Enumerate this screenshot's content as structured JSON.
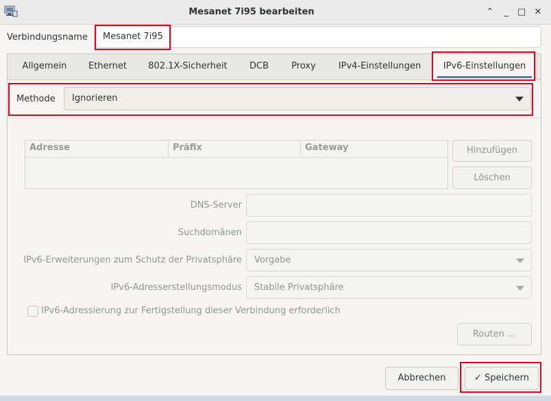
{
  "window": {
    "title": "Mesanet 7i95 bearbeiten",
    "minimize_glyph": "⌃",
    "minimize2_glyph": "_",
    "maximize_glyph": "□",
    "close_glyph": "✕"
  },
  "connection": {
    "name_label": "Verbindungsname",
    "name_value": "Mesanet 7i95"
  },
  "tabs": [
    {
      "label": "Allgemein"
    },
    {
      "label": "Ethernet"
    },
    {
      "label": "802.1X-Sicherheit"
    },
    {
      "label": "DCB"
    },
    {
      "label": "Proxy"
    },
    {
      "label": "IPv4-Einstellungen"
    },
    {
      "label": "IPv6-Einstellungen"
    }
  ],
  "ipv6": {
    "method_label": "Methode",
    "method_value": "Ignorieren",
    "address_table": {
      "columns": [
        "Adresse",
        "Präfix",
        "Gateway"
      ],
      "rows": []
    },
    "add_button": "Hinzufügen",
    "delete_button": "Löschen",
    "dns_label": "DNS-Server",
    "dns_value": "",
    "search_domains_label": "Suchdomänen",
    "search_domains_value": "",
    "privacy_label": "IPv6-Erweiterungen zum Schutz der Privatsphäre",
    "privacy_value": "Vorgabe",
    "addr_gen_label": "IPv6-Adresserstellungsmodus",
    "addr_gen_value": "Stabile Privatsphäre",
    "require_label": "IPv6-Adressierung zur Fertigstellung dieser Verbindung erforderlich",
    "require_checked": false,
    "routes_button": "Routen …"
  },
  "footer": {
    "cancel_button": "Abbrechen",
    "save_button": "Speichern",
    "save_icon_glyph": "✓"
  },
  "icons": {
    "app": "network-connection-icon",
    "checkmark": "checkmark-icon",
    "dropdown": "chevron-down-icon"
  },
  "colors": {
    "accent": "#3584e4",
    "highlight": "#e8001c"
  }
}
